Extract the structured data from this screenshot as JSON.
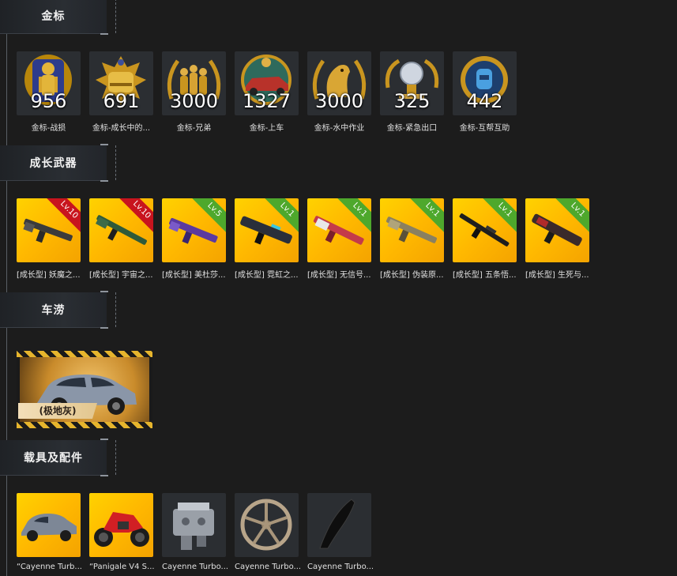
{
  "sections": {
    "medals": {
      "title": "金标"
    },
    "weapons": {
      "title": "成长武器"
    },
    "skins": {
      "title": "车涝"
    },
    "vehicles": {
      "title": "载具及配件"
    }
  },
  "medals": [
    {
      "count": "956",
      "label": "金标-战损",
      "icon": "soldier-medal-icon"
    },
    {
      "count": "691",
      "label": "金标-成长中的...",
      "icon": "helmet-medal-icon"
    },
    {
      "count": "3000",
      "label": "金标-兄弟",
      "icon": "brothers-medal-icon"
    },
    {
      "count": "1327",
      "label": "金标-上车",
      "icon": "car-medal-icon"
    },
    {
      "count": "3000",
      "label": "金标-水中作业",
      "icon": "seal-medal-icon"
    },
    {
      "count": "325",
      "label": "金标-紧急出口",
      "icon": "orb-medal-icon"
    },
    {
      "count": "442",
      "label": "金标-互帮互助",
      "icon": "backpack-medal-icon"
    }
  ],
  "weapons": [
    {
      "level": "Lv.10",
      "badge": "red",
      "label": "[成长型] 妖魔之..."
    },
    {
      "level": "Lv.10",
      "badge": "red",
      "label": "[成长型] 宇宙之..."
    },
    {
      "level": "Lv.5",
      "badge": "green",
      "label": "[成长型] 美杜莎..."
    },
    {
      "level": "Lv.1",
      "badge": "green",
      "label": "[成长型] 霓虹之..."
    },
    {
      "level": "Lv.1",
      "badge": "green",
      "label": "[成长型] 无信号..."
    },
    {
      "level": "Lv.1",
      "badge": "green",
      "label": "[成长型] 伪装原..."
    },
    {
      "level": "Lv.1",
      "badge": "green",
      "label": "[成长型] 五条悟..."
    },
    {
      "level": "Lv.1",
      "badge": "green",
      "label": "[成长型] 生死与..."
    }
  ],
  "car_skin": {
    "label": "(极地灰)"
  },
  "vehicles": [
    {
      "label": "“Cayenne Turb...",
      "bg": "gold",
      "icon": "suv-car-icon"
    },
    {
      "label": "“Panigale V4 S...",
      "bg": "gold",
      "icon": "motorcycle-icon"
    },
    {
      "label": "Cayenne Turbo...",
      "bg": "dark",
      "icon": "engine-part-icon"
    },
    {
      "label": "Cayenne Turbo...",
      "bg": "dark",
      "icon": "wheel-rim-icon"
    },
    {
      "label": "Cayenne Turbo...",
      "bg": "dark",
      "icon": "spoiler-part-icon"
    }
  ],
  "colors": {
    "background": "#1c1c1c",
    "gold": "#ffc400",
    "red_badge": "#c8141e",
    "green_badge": "#4ea82c"
  }
}
